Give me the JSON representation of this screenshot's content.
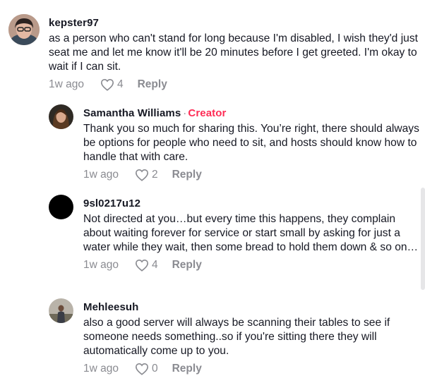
{
  "comments": [
    {
      "username": "kepster97",
      "text": "as a person who can't stand for long because I'm disabled, I wish they'd just seat me and let me know it'll be 20 minutes before I get greeted. I'm okay to wait if I can sit.",
      "time": "1w ago",
      "likes": "4",
      "reply_label": "Reply"
    },
    {
      "username": "Samantha Williams",
      "creator_sep": "·",
      "creator_label": "Creator",
      "text": "Thank you so much for sharing this. You’re right, there should always be options for people who need to sit, and hosts should know how to handle that with care.",
      "time": "1w ago",
      "likes": "2",
      "reply_label": "Reply"
    },
    {
      "username": "9sl0217u12",
      "text": "Not directed at you…but every time this happens, they complain about waiting forever for service or start small by asking for just a water while they wait, then some bread to hold them down & so on…",
      "time": "1w ago",
      "likes": "4",
      "reply_label": "Reply"
    },
    {
      "username": "Mehleesuh",
      "text": "also a good server will always be scanning their tables to see if someone needs something..so if you're sitting there they will automatically come up to you.",
      "time": "1w ago",
      "likes": "0",
      "reply_label": "Reply"
    }
  ],
  "colors": {
    "text": "#161823",
    "muted": "#8a8b91",
    "creator": "#fe2c55"
  },
  "icons": {
    "like": "heart-outline-icon"
  }
}
